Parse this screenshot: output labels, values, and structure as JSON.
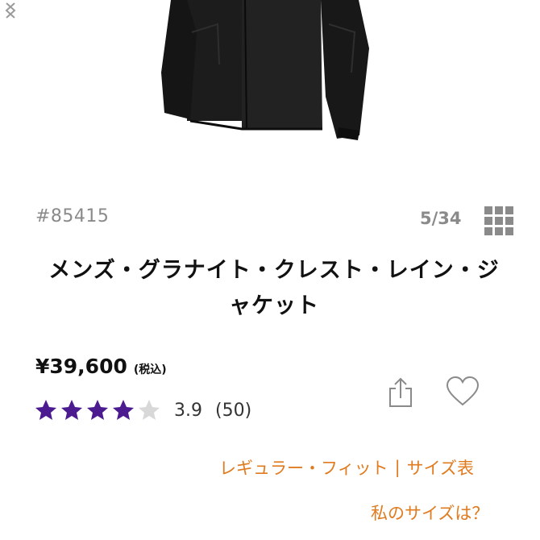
{
  "product": {
    "id": "#85415",
    "image_counter": "5/34",
    "title_line1": "メンズ・グラナイト・クレスト・レイン・ジ",
    "title_line2": "ャケット",
    "price": "¥39,600",
    "tax_note": "(税込)",
    "rating_value": "3.9",
    "rating_count": "(50)",
    "rating": 3.9,
    "rating_max": 5
  },
  "links": {
    "fit": "レギュラー・フィット",
    "separator": "|",
    "size_chart": "サイズ表",
    "my_size": "私のサイズは？"
  },
  "colors": {
    "accent": "#e07b1f",
    "star_filled": "#4b1b8f",
    "star_empty": "#d8d8d8",
    "jacket": "#1c1c1c"
  },
  "icons": {
    "nav_left": "chevron-left-icon",
    "nav_right": "chevron-right-icon",
    "gallery": "grid-icon",
    "share": "share-icon",
    "favorite": "heart-icon"
  }
}
